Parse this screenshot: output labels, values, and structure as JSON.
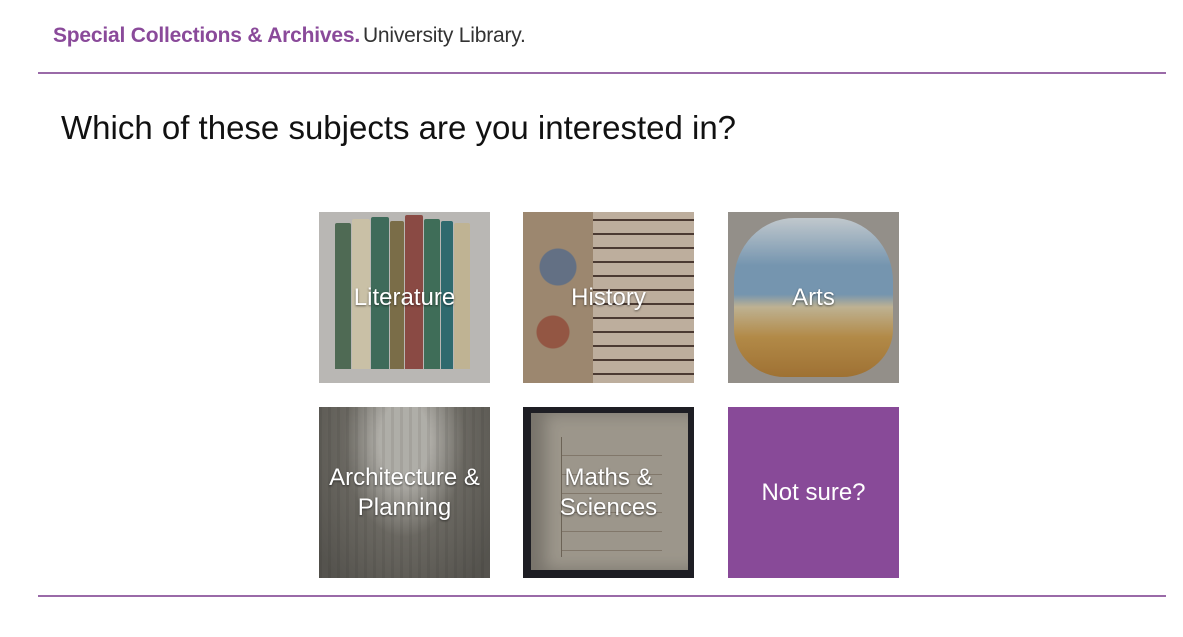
{
  "header": {
    "brand": "Special Collections & Archives.",
    "sub": "University Library."
  },
  "question": "Which of these subjects are you interested in?",
  "tiles": [
    {
      "label": "Literature"
    },
    {
      "label": "History"
    },
    {
      "label": "Arts"
    },
    {
      "label": "Architecture & Planning"
    },
    {
      "label": "Maths & Sciences"
    },
    {
      "label": "Not sure?"
    }
  ],
  "colors": {
    "accent": "#884a98",
    "rule": "#9a6aa8",
    "brand_text": "#8a4a9a"
  }
}
